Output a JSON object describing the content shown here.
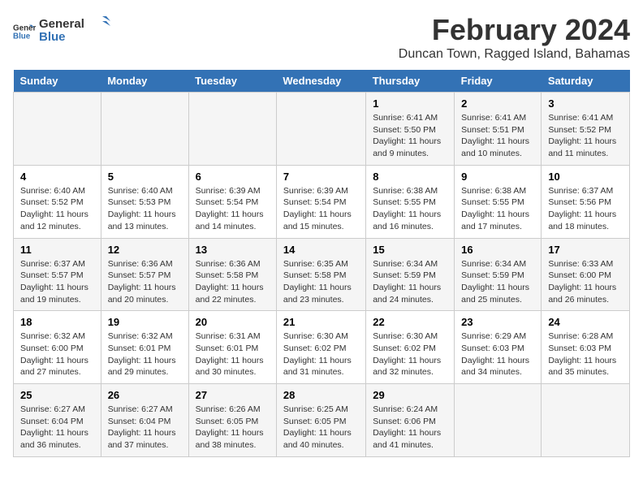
{
  "logo": {
    "line1": "General",
    "line2": "Blue"
  },
  "title": "February 2024",
  "subtitle": "Duncan Town, Ragged Island, Bahamas",
  "days_of_week": [
    "Sunday",
    "Monday",
    "Tuesday",
    "Wednesday",
    "Thursday",
    "Friday",
    "Saturday"
  ],
  "weeks": [
    [
      {
        "day": "",
        "info": ""
      },
      {
        "day": "",
        "info": ""
      },
      {
        "day": "",
        "info": ""
      },
      {
        "day": "",
        "info": ""
      },
      {
        "day": "1",
        "info": "Sunrise: 6:41 AM\nSunset: 5:50 PM\nDaylight: 11 hours and 9 minutes."
      },
      {
        "day": "2",
        "info": "Sunrise: 6:41 AM\nSunset: 5:51 PM\nDaylight: 11 hours and 10 minutes."
      },
      {
        "day": "3",
        "info": "Sunrise: 6:41 AM\nSunset: 5:52 PM\nDaylight: 11 hours and 11 minutes."
      }
    ],
    [
      {
        "day": "4",
        "info": "Sunrise: 6:40 AM\nSunset: 5:52 PM\nDaylight: 11 hours and 12 minutes."
      },
      {
        "day": "5",
        "info": "Sunrise: 6:40 AM\nSunset: 5:53 PM\nDaylight: 11 hours and 13 minutes."
      },
      {
        "day": "6",
        "info": "Sunrise: 6:39 AM\nSunset: 5:54 PM\nDaylight: 11 hours and 14 minutes."
      },
      {
        "day": "7",
        "info": "Sunrise: 6:39 AM\nSunset: 5:54 PM\nDaylight: 11 hours and 15 minutes."
      },
      {
        "day": "8",
        "info": "Sunrise: 6:38 AM\nSunset: 5:55 PM\nDaylight: 11 hours and 16 minutes."
      },
      {
        "day": "9",
        "info": "Sunrise: 6:38 AM\nSunset: 5:55 PM\nDaylight: 11 hours and 17 minutes."
      },
      {
        "day": "10",
        "info": "Sunrise: 6:37 AM\nSunset: 5:56 PM\nDaylight: 11 hours and 18 minutes."
      }
    ],
    [
      {
        "day": "11",
        "info": "Sunrise: 6:37 AM\nSunset: 5:57 PM\nDaylight: 11 hours and 19 minutes."
      },
      {
        "day": "12",
        "info": "Sunrise: 6:36 AM\nSunset: 5:57 PM\nDaylight: 11 hours and 20 minutes."
      },
      {
        "day": "13",
        "info": "Sunrise: 6:36 AM\nSunset: 5:58 PM\nDaylight: 11 hours and 22 minutes."
      },
      {
        "day": "14",
        "info": "Sunrise: 6:35 AM\nSunset: 5:58 PM\nDaylight: 11 hours and 23 minutes."
      },
      {
        "day": "15",
        "info": "Sunrise: 6:34 AM\nSunset: 5:59 PM\nDaylight: 11 hours and 24 minutes."
      },
      {
        "day": "16",
        "info": "Sunrise: 6:34 AM\nSunset: 5:59 PM\nDaylight: 11 hours and 25 minutes."
      },
      {
        "day": "17",
        "info": "Sunrise: 6:33 AM\nSunset: 6:00 PM\nDaylight: 11 hours and 26 minutes."
      }
    ],
    [
      {
        "day": "18",
        "info": "Sunrise: 6:32 AM\nSunset: 6:00 PM\nDaylight: 11 hours and 27 minutes."
      },
      {
        "day": "19",
        "info": "Sunrise: 6:32 AM\nSunset: 6:01 PM\nDaylight: 11 hours and 29 minutes."
      },
      {
        "day": "20",
        "info": "Sunrise: 6:31 AM\nSunset: 6:01 PM\nDaylight: 11 hours and 30 minutes."
      },
      {
        "day": "21",
        "info": "Sunrise: 6:30 AM\nSunset: 6:02 PM\nDaylight: 11 hours and 31 minutes."
      },
      {
        "day": "22",
        "info": "Sunrise: 6:30 AM\nSunset: 6:02 PM\nDaylight: 11 hours and 32 minutes."
      },
      {
        "day": "23",
        "info": "Sunrise: 6:29 AM\nSunset: 6:03 PM\nDaylight: 11 hours and 34 minutes."
      },
      {
        "day": "24",
        "info": "Sunrise: 6:28 AM\nSunset: 6:03 PM\nDaylight: 11 hours and 35 minutes."
      }
    ],
    [
      {
        "day": "25",
        "info": "Sunrise: 6:27 AM\nSunset: 6:04 PM\nDaylight: 11 hours and 36 minutes."
      },
      {
        "day": "26",
        "info": "Sunrise: 6:27 AM\nSunset: 6:04 PM\nDaylight: 11 hours and 37 minutes."
      },
      {
        "day": "27",
        "info": "Sunrise: 6:26 AM\nSunset: 6:05 PM\nDaylight: 11 hours and 38 minutes."
      },
      {
        "day": "28",
        "info": "Sunrise: 6:25 AM\nSunset: 6:05 PM\nDaylight: 11 hours and 40 minutes."
      },
      {
        "day": "29",
        "info": "Sunrise: 6:24 AM\nSunset: 6:06 PM\nDaylight: 11 hours and 41 minutes."
      },
      {
        "day": "",
        "info": ""
      },
      {
        "day": "",
        "info": ""
      }
    ]
  ]
}
